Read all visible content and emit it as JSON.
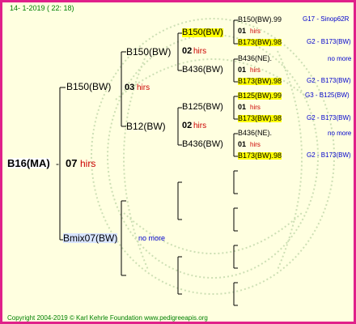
{
  "header": {
    "date": "14- 1-2019 ( 22: 18)"
  },
  "footer": {
    "copyright": "Copyright 2004-2019 © Karl Kehrle Foundation www.pedigreeapis.org"
  },
  "gen1": {
    "name": "B16(MA)",
    "hives": "07",
    "unit": "hirs"
  },
  "gen2": [
    {
      "name": "B150(BW)",
      "hives": "03",
      "unit": "hirs"
    },
    {
      "name": "Bmix07(BW)",
      "note": "no more"
    }
  ],
  "gen3": [
    {
      "name": "B150(BW)",
      "hives": "02",
      "unit": "hirs"
    },
    {
      "name": "B12(BW)",
      "hives": "02",
      "unit": "hirs"
    }
  ],
  "gen4": [
    {
      "name": "B150(BW)",
      "highlight": true
    },
    {
      "name": "B436(BW)"
    },
    {
      "name": "B125(BW)"
    },
    {
      "name": "B436(BW)"
    }
  ],
  "gen5": [
    {
      "name": "B150(BW).99",
      "hives": "01",
      "unit": "hirs",
      "mother": "B173(BW).98",
      "mother_highlight": true,
      "info1": "G17 - Sinop62R",
      "info2": "G2 - B173(BW)"
    },
    {
      "name": "B436(NE).",
      "hives": "01",
      "unit": "hirs",
      "mother": "B173(BW).98",
      "mother_highlight": true,
      "info1": "no more",
      "info2": "G2 - B173(BW)"
    },
    {
      "name": "B125(BW).99",
      "name_highlight": true,
      "hives": "01",
      "unit": "hirs",
      "mother": "B173(BW).98",
      "mother_highlight": true,
      "info1": "G3 - B125(BW)",
      "info2": "G2 - B173(BW)"
    },
    {
      "name": "B436(NE).",
      "hives": "01",
      "unit": "hirs",
      "mother": "B173(BW).98",
      "mother_highlight": true,
      "info1": "no more",
      "info2": "G2 - B173(BW)"
    }
  ],
  "colors": {
    "border": "#e0208a",
    "background": "#ffffe0",
    "highlight": "#ffff00",
    "hirs": "#cc0000",
    "info": "#0000cc",
    "footer": "#008000",
    "header": "#008000"
  }
}
